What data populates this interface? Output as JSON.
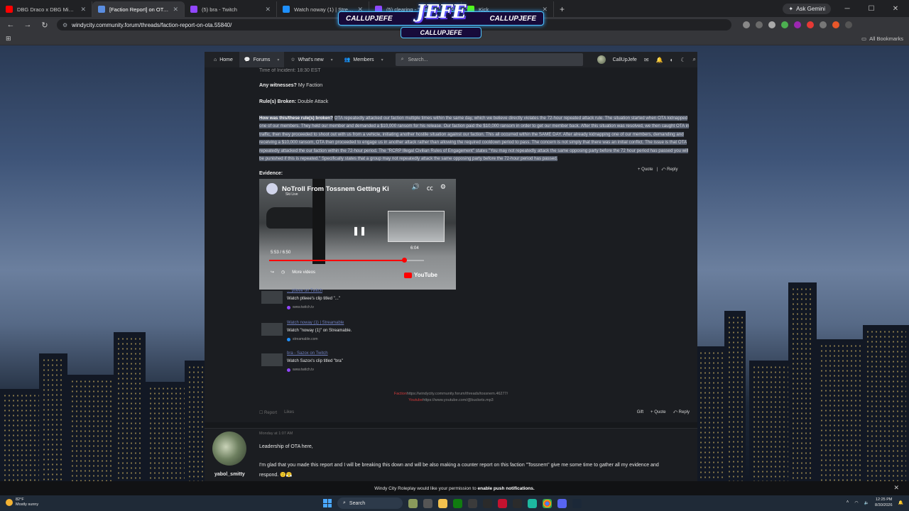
{
  "browser": {
    "tabs": [
      {
        "title": "DBG Draco x DBG Mike x E",
        "color": "#ff0000",
        "active": false
      },
      {
        "title": "[Faction Report] on OTA | W",
        "color": "#5a8de0",
        "active": true
      },
      {
        "title": "(5) bra - Twitch",
        "color": "#9146ff",
        "active": false
      },
      {
        "title": "Watch noway (1) | Streamable",
        "color": "#1e90ff",
        "active": false
      },
      {
        "title": "(5) clearing - Twitch",
        "color": "#9146ff",
        "active": false
      },
      {
        "title": "Kick",
        "color": "#53fc18",
        "active": false
      }
    ],
    "new_tab": "+",
    "ask_gemini": "Ask Gemini",
    "url": "windycity.community.forum/threads/faction-report-on-ota.55840/",
    "all_bookmarks": "All Bookmarks"
  },
  "overlay": {
    "logo": "JEFE",
    "left_handle": "CALLUPJEFE",
    "right_handle": "CALLUPJEFE",
    "bottom_handle": "CALLUPJEFE"
  },
  "forum_nav": {
    "items": [
      {
        "label": "Home",
        "icon": "home-icon"
      },
      {
        "label": "Forums",
        "icon": "chat-icon"
      },
      {
        "label": "What's new",
        "icon": "star-icon"
      },
      {
        "label": "Members",
        "icon": "users-icon"
      }
    ],
    "search_placeholder": "Search...",
    "username": "CallUpJefe"
  },
  "post": {
    "partial_line": "Time of Incident: 18:30 EST",
    "witnesses_label": "Any witnesses?",
    "witnesses_value": "My Faction",
    "rules_label": "Rule(s) Broken:",
    "rules_value": "Double Attack",
    "how_label": "How was this/these rule(s) broken?",
    "how_text": "OTA repeatedly attacked our faction multiple times within the same day, which we believe directly violates the 72-hour repeated attack rule. The situation started when OTA kidnapped one of our members. They held our member and demanded a $10,000 ransom for his release. Our faction paid the $10,000 ransom in order to get our member back. After this situation was resolved, we then caught OTA in traffic, then they proceeded to shoot out with us from a vehicle, initiating another hostile situation against our faction. This all occurred within the SAME DAY. After already kidnapping one of our members, demanding and receiving a $10,000 ransom, OTA then proceeded to engage us in another attack rather than allowing the required cooldown period to pass. The concern is not simply that there was an initial conflict. The issue is that OTA repeatedly attacked the our faction within the 72-hour period. The \"RCRP Illegal Civilian Rules of Engagement\" states \"You may not repeatedly attack the same opposing party before the 72 hour period has passed you will be punished if this is repeated.\" Specifically states that a group may not repeatedly attack the same opposing party before the 72-hour period has passed.",
    "quote": "+ Quote",
    "reply": "Reply",
    "evidence_label": "Evidence:",
    "video": {
      "title": "NoTroll From Tossnem Getting Ki",
      "channel": "Ski Live",
      "time": "5:53 / 6:50",
      "pip_time": "6:04",
      "progress": 0.87,
      "more_videos": "More videos",
      "youtube": "YouTube"
    },
    "embeds": [
      {
        "title": "... ptleee on Twitch",
        "desc": "Watch ptleee's clip titled \"...\"",
        "source": "www.twitch.tv",
        "dot": "#9146ff"
      },
      {
        "title": "Watch noway (1) | Streamable",
        "desc": "Watch \"noway (1)\" on Streamable.",
        "source": "streamable.com",
        "dot": "#1e90ff"
      },
      {
        "title": "bra - Sazox on Twitch",
        "desc": "Watch Sazox's clip titled \"bra\"",
        "source": "www.twitch.tv",
        "dot": "#9146ff"
      }
    ],
    "signature": [
      {
        "label": "Faction",
        "text": "https://windycity.community.forum/threads/tossnem.46277/"
      },
      {
        "label": "Youtube",
        "text": "https://www.youtube.com/@buckets.mp3"
      }
    ],
    "report": "Report",
    "likes": "Likes",
    "gift": "Gift",
    "footer_quote": "+ Quote",
    "footer_reply": "Reply"
  },
  "reply_post": {
    "date": "Monday at 1:07 AM",
    "username": "yabol_smitty",
    "greeting": "Leadership of OTA here,",
    "line1": "I'm glad that you made this report and I will be breaking this down and will be also making a counter report on this faction \"Tossnem\" give me some time to gather all my evidence and",
    "line2": "respond. 🙂😤"
  },
  "push": {
    "text": "Windy City Roleplay would like your permission to",
    "bold": "enable push notifications."
  },
  "taskbar": {
    "temp": "82°F",
    "weather": "Mostly sunny",
    "search": "Search",
    "time": "12:25 PM",
    "date": "8/30/2026"
  }
}
